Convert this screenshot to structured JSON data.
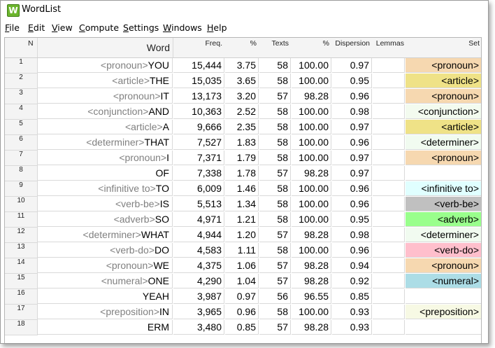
{
  "window": {
    "title": "WordList",
    "icon_letter": "W"
  },
  "menu": [
    "File",
    "Edit",
    "View",
    "Compute",
    "Settings",
    "Windows",
    "Help"
  ],
  "columns": {
    "n": "N",
    "word": "Word",
    "freq": "Freq.",
    "pct": "%",
    "texts": "Texts",
    "pct_texts": "%",
    "dispersion": "Dispersion",
    "lemmas": "Lemmas",
    "set": "Set"
  },
  "set_colors": {
    "<pronoun>": "#f6d8b0",
    "<article>": "#efe287",
    "<conjunction>": "#f3fbef",
    "<determiner>": "#f1fbf0",
    "<infinitive to>": "#e0ffff",
    "<verb-be>": "#c0c0c0",
    "<adverb>": "#99ff8c",
    "<verb-do>": "#ffbfcc",
    "<numeral>": "#acdde6",
    "<preposition>": "#f7f9e4"
  },
  "rows": [
    {
      "n": "1",
      "tag": "<pronoun>",
      "word": "YOU",
      "freq": "15,444",
      "pct": "3.75",
      "texts": "58",
      "pct_texts": "100.00",
      "dispersion": "0.97",
      "lemmas": "",
      "set": "<pronoun>"
    },
    {
      "n": "2",
      "tag": "<article>",
      "word": "THE",
      "freq": "15,035",
      "pct": "3.65",
      "texts": "58",
      "pct_texts": "100.00",
      "dispersion": "0.95",
      "lemmas": "",
      "set": "<article>"
    },
    {
      "n": "3",
      "tag": "<pronoun>",
      "word": "IT",
      "freq": "13,173",
      "pct": "3.20",
      "texts": "57",
      "pct_texts": "98.28",
      "dispersion": "0.96",
      "lemmas": "",
      "set": "<pronoun>"
    },
    {
      "n": "4",
      "tag": "<conjunction>",
      "word": "AND",
      "freq": "10,363",
      "pct": "2.52",
      "texts": "58",
      "pct_texts": "100.00",
      "dispersion": "0.98",
      "lemmas": "",
      "set": "<conjunction>"
    },
    {
      "n": "5",
      "tag": "<article>",
      "word": "A",
      "freq": "9,666",
      "pct": "2.35",
      "texts": "58",
      "pct_texts": "100.00",
      "dispersion": "0.97",
      "lemmas": "",
      "set": "<article>"
    },
    {
      "n": "6",
      "tag": "<determiner>",
      "word": "THAT",
      "freq": "7,527",
      "pct": "1.83",
      "texts": "58",
      "pct_texts": "100.00",
      "dispersion": "0.96",
      "lemmas": "",
      "set": "<determiner>"
    },
    {
      "n": "7",
      "tag": "<pronoun>",
      "word": "I",
      "freq": "7,371",
      "pct": "1.79",
      "texts": "58",
      "pct_texts": "100.00",
      "dispersion": "0.97",
      "lemmas": "",
      "set": "<pronoun>"
    },
    {
      "n": "8",
      "tag": "",
      "word": "OF",
      "freq": "7,338",
      "pct": "1.78",
      "texts": "57",
      "pct_texts": "98.28",
      "dispersion": "0.97",
      "lemmas": "",
      "set": ""
    },
    {
      "n": "9",
      "tag": "<infinitive to>",
      "word": "TO",
      "freq": "6,009",
      "pct": "1.46",
      "texts": "58",
      "pct_texts": "100.00",
      "dispersion": "0.96",
      "lemmas": "",
      "set": "<infinitive to>"
    },
    {
      "n": "10",
      "tag": "<verb-be>",
      "word": "IS",
      "freq": "5,513",
      "pct": "1.34",
      "texts": "58",
      "pct_texts": "100.00",
      "dispersion": "0.96",
      "lemmas": "",
      "set": "<verb-be>"
    },
    {
      "n": "11",
      "tag": "<adverb>",
      "word": "SO",
      "freq": "4,971",
      "pct": "1.21",
      "texts": "58",
      "pct_texts": "100.00",
      "dispersion": "0.95",
      "lemmas": "",
      "set": "<adverb>"
    },
    {
      "n": "12",
      "tag": "<determiner>",
      "word": "WHAT",
      "freq": "4,944",
      "pct": "1.20",
      "texts": "57",
      "pct_texts": "98.28",
      "dispersion": "0.98",
      "lemmas": "",
      "set": "<determiner>"
    },
    {
      "n": "13",
      "tag": "<verb-do>",
      "word": "DO",
      "freq": "4,583",
      "pct": "1.11",
      "texts": "58",
      "pct_texts": "100.00",
      "dispersion": "0.96",
      "lemmas": "",
      "set": "<verb-do>"
    },
    {
      "n": "14",
      "tag": "<pronoun>",
      "word": "WE",
      "freq": "4,375",
      "pct": "1.06",
      "texts": "57",
      "pct_texts": "98.28",
      "dispersion": "0.94",
      "lemmas": "",
      "set": "<pronoun>"
    },
    {
      "n": "15",
      "tag": "<numeral>",
      "word": "ONE",
      "freq": "4,290",
      "pct": "1.04",
      "texts": "57",
      "pct_texts": "98.28",
      "dispersion": "0.92",
      "lemmas": "",
      "set": "<numeral>"
    },
    {
      "n": "16",
      "tag": "",
      "word": "YEAH",
      "freq": "3,987",
      "pct": "0.97",
      "texts": "56",
      "pct_texts": "96.55",
      "dispersion": "0.85",
      "lemmas": "",
      "set": ""
    },
    {
      "n": "17",
      "tag": "<preposition>",
      "word": "IN",
      "freq": "3,965",
      "pct": "0.96",
      "texts": "58",
      "pct_texts": "100.00",
      "dispersion": "0.93",
      "lemmas": "",
      "set": "<preposition>"
    },
    {
      "n": "18",
      "tag": "",
      "word": "ERM",
      "freq": "3,480",
      "pct": "0.85",
      "texts": "57",
      "pct_texts": "98.28",
      "dispersion": "0.93",
      "lemmas": "",
      "set": ""
    }
  ]
}
